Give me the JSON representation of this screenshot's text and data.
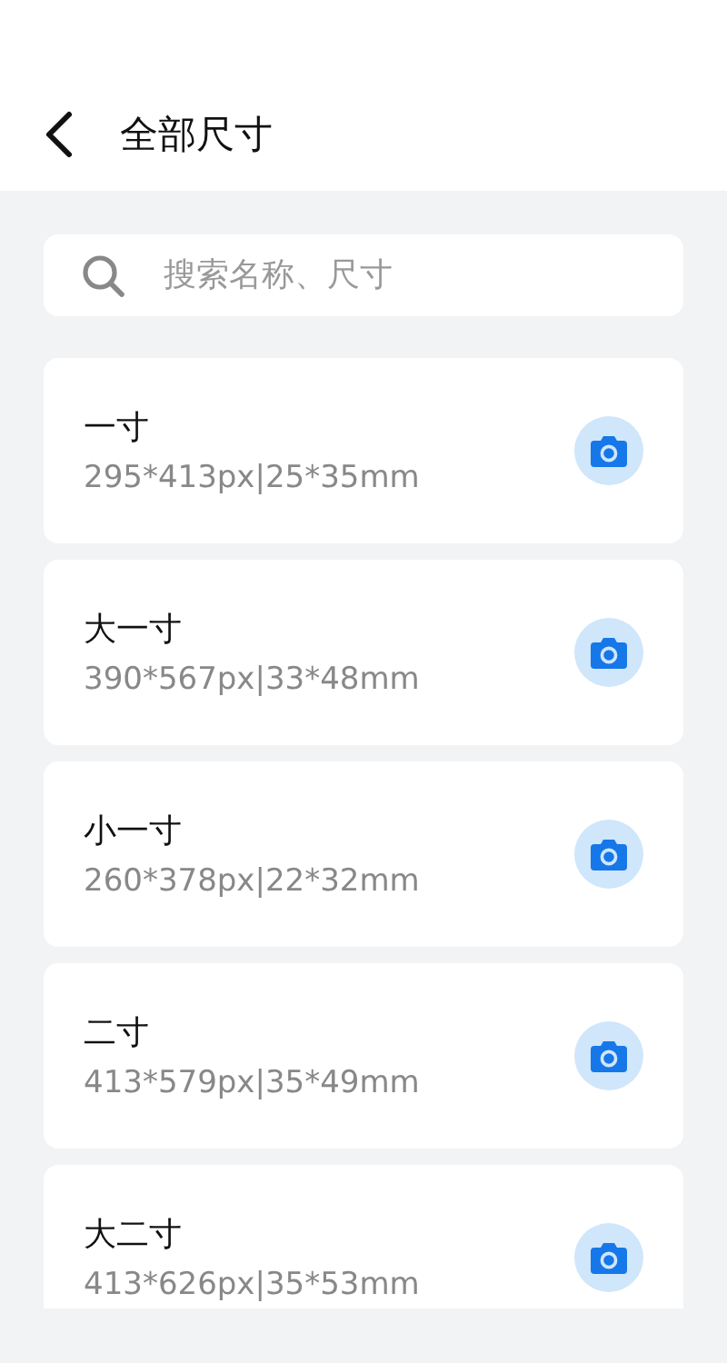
{
  "header": {
    "title": "全部尺寸"
  },
  "search": {
    "placeholder": "搜索名称、尺寸"
  },
  "sizes": [
    {
      "name": "一寸",
      "spec": "295*413px|25*35mm"
    },
    {
      "name": "大一寸",
      "spec": "390*567px|33*48mm"
    },
    {
      "name": "小一寸",
      "spec": "260*378px|22*32mm"
    },
    {
      "name": "二寸",
      "spec": "413*579px|35*49mm"
    },
    {
      "name": "大二寸",
      "spec": "413*626px|35*53mm"
    }
  ]
}
